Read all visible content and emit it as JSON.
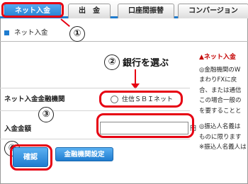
{
  "tabs": [
    {
      "label": "ネット入金",
      "active": true
    },
    {
      "label": "出　金",
      "active": false
    },
    {
      "label": "口座間振替",
      "active": false
    },
    {
      "label": "コンバージョン",
      "active": false
    }
  ],
  "section": {
    "title": "ネット入金"
  },
  "annotations": {
    "step1": "①",
    "step2": "②",
    "step2_text": "銀行を選ぶ",
    "step3": "③",
    "step4": "④"
  },
  "form": {
    "bank_label": "ネット入金金融機関",
    "bank_option": "住信ＳＢＩネット",
    "amount_label": "入金金額",
    "amount_value": "",
    "yen": "円"
  },
  "buttons": {
    "confirm": "確認",
    "bank_settings": "金融機関設定"
  },
  "notes": {
    "title": "▲ネット入金",
    "lines": [
      "◎金融機関のW",
      "まわりFXに戻",
      "合、または通信",
      "この場合一般の",
      "を要することと"
    ],
    "lines2": [
      "◎振込人名義は",
      "ものに限ります",
      "※振込人名義人は"
    ]
  },
  "colors": {
    "accent": "#1f7ccf",
    "annotation": "#e60012",
    "warning": "#c40000"
  }
}
